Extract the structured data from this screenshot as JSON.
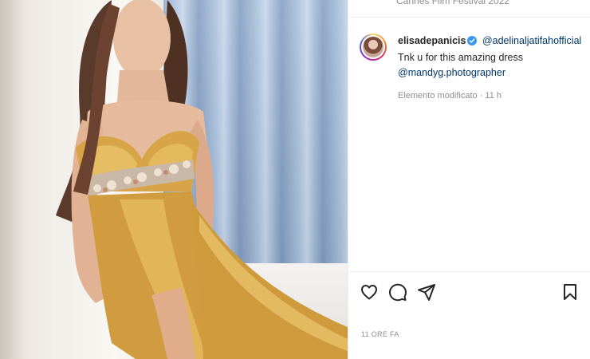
{
  "post": {
    "location": "Cannes Film Festival 2022",
    "photo_description_icon": "photo-icon"
  },
  "comment": {
    "username": "elisadepanicis",
    "mention_1": "@adelinaljatifahofficial",
    "caption": "Tnk u for this amazing dress",
    "mention_2": "@mandyg.photographer",
    "meta": "Elemento modificato · 11 h"
  },
  "actions": {
    "like_icon": "heart-icon",
    "comment_icon": "comment-icon",
    "share_icon": "paper-plane-icon",
    "save_icon": "bookmark-icon"
  },
  "timestamp": "11 ORE FA",
  "colors": {
    "mention": "#00376b",
    "verified": "#3897f0",
    "muted": "#8e8e8e",
    "dress": "#d9a94a"
  }
}
